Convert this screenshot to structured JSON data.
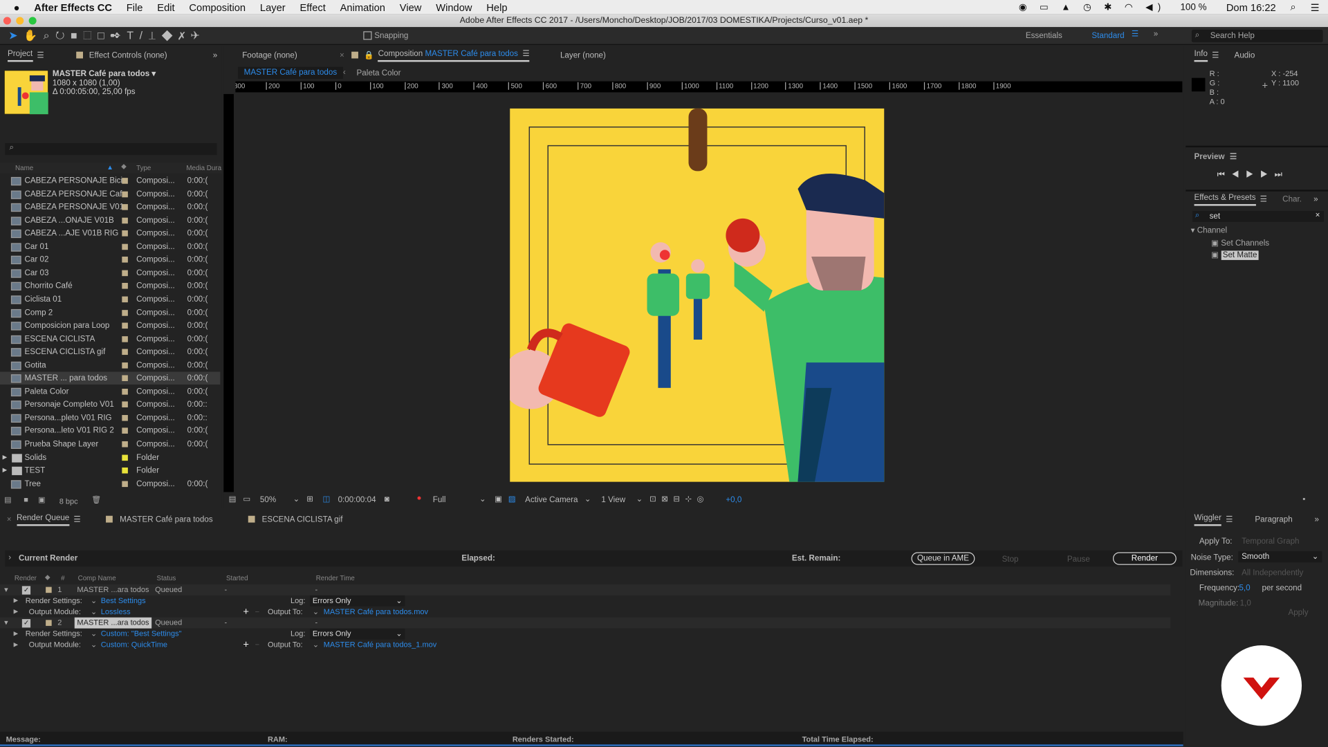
{
  "menubar": {
    "app": "After Effects CC",
    "items": [
      "File",
      "Edit",
      "Composition",
      "Layer",
      "Effect",
      "Animation",
      "View",
      "Window",
      "Help"
    ],
    "battery": "100 %",
    "clock": "Dom 16:22"
  },
  "window": {
    "title": "Adobe After Effects CC 2017 - /Users/Moncho/Desktop/JOB/2017/03 DOMESTIKA/Projects/Curso_v01.aep *"
  },
  "toolbar": {
    "snapping": "Snapping",
    "workspaces": [
      "Essentials",
      "Standard"
    ],
    "search_placeholder": "Search Help"
  },
  "project": {
    "tab": "Project",
    "tab2": "Effect Controls (none)",
    "comp_name": "MASTER Café para todos ▾",
    "comp_size": "1080 x 1080 (1,00)",
    "comp_dur": "Δ 0:00:05:00, 25,00 fps",
    "columns": [
      "Name",
      "Type",
      "Media Dura"
    ],
    "items": [
      {
        "name": "CABEZA PERSONAJE Bici",
        "type": "Composi...",
        "dur": "0:00:(",
        "kind": "comp"
      },
      {
        "name": "CABEZA PERSONAJE Cafe",
        "type": "Composi...",
        "dur": "0:00:(",
        "kind": "comp"
      },
      {
        "name": "CABEZA PERSONAJE V01",
        "type": "Composi...",
        "dur": "0:00:(",
        "kind": "comp"
      },
      {
        "name": "CABEZA ...ONAJE V01B",
        "type": "Composi...",
        "dur": "0:00:(",
        "kind": "comp"
      },
      {
        "name": "CABEZA ...AJE V01B RIG",
        "type": "Composi...",
        "dur": "0:00:(",
        "kind": "comp"
      },
      {
        "name": "Car 01",
        "type": "Composi...",
        "dur": "0:00:(",
        "kind": "comp"
      },
      {
        "name": "Car 02",
        "type": "Composi...",
        "dur": "0:00:(",
        "kind": "comp"
      },
      {
        "name": "Car 03",
        "type": "Composi...",
        "dur": "0:00:(",
        "kind": "comp"
      },
      {
        "name": "Chorrito Café",
        "type": "Composi...",
        "dur": "0:00:(",
        "kind": "comp"
      },
      {
        "name": "Ciclista 01",
        "type": "Composi...",
        "dur": "0:00:(",
        "kind": "comp"
      },
      {
        "name": "Comp 2",
        "type": "Composi...",
        "dur": "0:00:(",
        "kind": "comp"
      },
      {
        "name": "Composicion para Loop",
        "type": "Composi...",
        "dur": "0:00:(",
        "kind": "comp"
      },
      {
        "name": "ESCENA CICLISTA",
        "type": "Composi...",
        "dur": "0:00:(",
        "kind": "comp"
      },
      {
        "name": "ESCENA CICLISTA gif",
        "type": "Composi...",
        "dur": "0:00:(",
        "kind": "comp"
      },
      {
        "name": "Gotita",
        "type": "Composi...",
        "dur": "0:00:(",
        "kind": "comp"
      },
      {
        "name": "MASTER ... para todos",
        "type": "Composi...",
        "dur": "0:00:(",
        "kind": "comp",
        "selected": true
      },
      {
        "name": "Paleta Color",
        "type": "Composi...",
        "dur": "0:00:(",
        "kind": "comp"
      },
      {
        "name": "Personaje Completo V01",
        "type": "Composi...",
        "dur": "0:00::",
        "kind": "comp"
      },
      {
        "name": "Persona...pleto V01 RIG",
        "type": "Composi...",
        "dur": "0:00::",
        "kind": "comp"
      },
      {
        "name": "Persona...leto V01 RIG 2",
        "type": "Composi...",
        "dur": "0:00:(",
        "kind": "comp"
      },
      {
        "name": "Prueba Shape Layer",
        "type": "Composi...",
        "dur": "0:00:(",
        "kind": "comp"
      },
      {
        "name": "Solids",
        "type": "Folder",
        "dur": "",
        "kind": "folder"
      },
      {
        "name": "TEST",
        "type": "Folder",
        "dur": "",
        "kind": "folder"
      },
      {
        "name": "Tree",
        "type": "Composi...",
        "dur": "0:00:(",
        "kind": "comp"
      }
    ],
    "bpc": "8 bpc"
  },
  "viewer": {
    "tabs": [
      "Footage (none)",
      "Composition",
      "MASTER Café para todos",
      "Layer (none)"
    ],
    "breadcrumbs": [
      "MASTER Café para todos",
      "Paleta Color"
    ],
    "ruler": [
      "300",
      "200",
      "100",
      "0",
      "100",
      "200",
      "300",
      "400",
      "500",
      "600",
      "700",
      "800",
      "900",
      "1000",
      "1100",
      "1200",
      "1300",
      "1400",
      "1500",
      "1600",
      "1700",
      "1800",
      "1900"
    ],
    "zoom": "50%",
    "timecode": "0:00:00:04",
    "resolution": "Full",
    "camera": "Active Camera",
    "views": "1 View",
    "exposure": "+0,0"
  },
  "info": {
    "tabs": [
      "Info",
      "Audio"
    ],
    "r": "R :",
    "g": "G :",
    "b": "B :",
    "a": "A : 0",
    "x": "X : -254",
    "y": "Y : 1100"
  },
  "preview": {
    "title": "Preview"
  },
  "effects": {
    "tabs": [
      "Effects & Presets",
      "Char."
    ],
    "search": "set",
    "category": "Channel",
    "items": [
      "Set Channels",
      "Set Matte"
    ]
  },
  "renderqueue": {
    "tabs": [
      "Render Queue",
      "MASTER Café para todos",
      "ESCENA CICLISTA gif"
    ],
    "current_render": "Current Render",
    "elapsed": "Elapsed:",
    "est_remain": "Est. Remain:",
    "queue_ame": "Queue in AME",
    "stop": "Stop",
    "pause": "Pause",
    "render": "Render",
    "columns": [
      "Render",
      "#",
      "Comp Name",
      "Status",
      "Started",
      "Render Time"
    ],
    "items": [
      {
        "num": "1",
        "comp": "MASTER ...ara todos",
        "status": "Queued",
        "started": "-",
        "time": "-",
        "render_settings": "Best Settings",
        "output_module": "Lossless",
        "log": "Errors Only",
        "output_to": "MASTER Café para todos.mov"
      },
      {
        "num": "2",
        "comp": "MASTER ...ara todos",
        "status": "Queued",
        "started": "-",
        "time": "-",
        "render_settings": "Custom: \"Best Settings\"",
        "output_module": "Custom: QuickTime",
        "log": "Errors Only",
        "output_to": "MASTER Café para todos_1.mov"
      }
    ],
    "labels": {
      "render_settings": "Render Settings:",
      "output_module": "Output Module:",
      "log": "Log:",
      "output_to": "Output To:"
    },
    "status": {
      "message": "Message:",
      "ram": "RAM:",
      "renders_started": "Renders Started:",
      "total": "Total Time Elapsed:"
    }
  },
  "wiggler": {
    "tabs": [
      "Wiggler",
      "Paragraph"
    ],
    "apply_to_label": "Apply To:",
    "apply_to": "Temporal Graph",
    "noise_label": "Noise Type:",
    "noise": "Smooth",
    "dim_label": "Dimensions:",
    "dim": "All Independently",
    "freq_label": "Frequency:",
    "freq": "5,0",
    "freq_unit": "per second",
    "mag_label": "Magnitude:",
    "mag": "1,0",
    "apply": "Apply"
  },
  "colors": {
    "accent": "#2d8ceb",
    "canvas": "#f9d43a",
    "logo": "#d0120f"
  }
}
